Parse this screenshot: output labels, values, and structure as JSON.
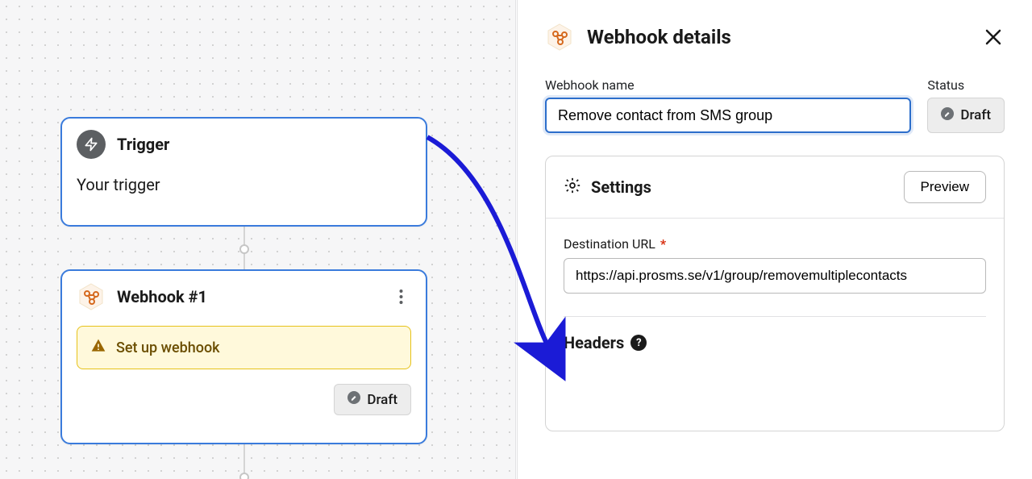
{
  "canvas": {
    "trigger": {
      "title": "Trigger",
      "subtitle": "Your trigger"
    },
    "webhook": {
      "title": "Webhook #1",
      "alert": "Set up webhook",
      "status": "Draft"
    }
  },
  "panel": {
    "title": "Webhook details",
    "name_label": "Webhook name",
    "name_value": "Remove contact from SMS group",
    "status_label": "Status",
    "status_value": "Draft",
    "settings": {
      "title": "Settings",
      "preview": "Preview",
      "dest_label": "Destination URL",
      "dest_value": "https://api.prosms.se/v1/group/removemultiplecontacts",
      "headers_title": "Headers"
    }
  }
}
